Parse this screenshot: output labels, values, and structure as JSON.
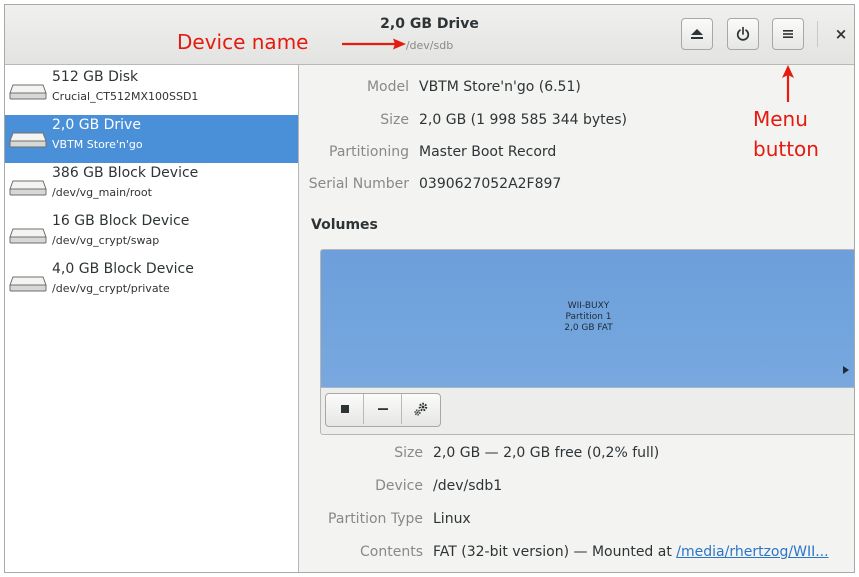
{
  "header": {
    "title": "2,0 GB Drive",
    "subtitle": "/dev/sdb",
    "close_glyph": "×"
  },
  "annotations": {
    "device_name": "Device name",
    "menu_line1": "Menu",
    "menu_line2": "button"
  },
  "sidebar": {
    "devices": [
      {
        "name": "512 GB Disk",
        "sub": "Crucial_CT512MX100SSD1",
        "selected": false
      },
      {
        "name": "2,0 GB Drive",
        "sub": "VBTM Store'n'go",
        "selected": true
      },
      {
        "name": "386 GB Block Device",
        "sub": "/dev/vg_main/root",
        "selected": false
      },
      {
        "name": "16 GB Block Device",
        "sub": "/dev/vg_crypt/swap",
        "selected": false
      },
      {
        "name": "4,0 GB Block Device",
        "sub": "/dev/vg_crypt/private",
        "selected": false
      }
    ]
  },
  "drive": {
    "model_label": "Model",
    "model": "VBTM Store'n'go (6.51)",
    "size_label": "Size",
    "size": "2,0 GB (1 998 585 344 bytes)",
    "partitioning_label": "Partitioning",
    "partitioning": "Master Boot Record",
    "serial_label": "Serial Number",
    "serial": "0390627052A2F897"
  },
  "volumes": {
    "heading": "Volumes",
    "partition": {
      "label": "WII-BUXY",
      "number": "Partition 1",
      "desc": "2,0 GB FAT"
    }
  },
  "partition_info": {
    "size_label": "Size",
    "size": "2,0 GB — 2,0 GB free (0,2% full)",
    "device_label": "Device",
    "device": "/dev/sdb1",
    "type_label": "Partition Type",
    "type": "Linux",
    "contents_label": "Contents",
    "contents": "FAT (32-bit version) — Mounted at ",
    "mount_link": "/media/rhertzog/WII..."
  },
  "colors": {
    "selection": "#4a90d9",
    "partition": "#74a5dd",
    "annotation": "#e41b10",
    "link": "#2a76c6"
  }
}
